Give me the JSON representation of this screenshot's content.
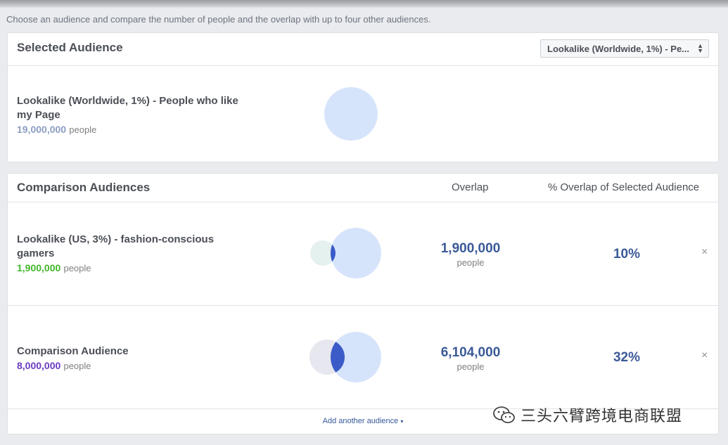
{
  "intro_text": "Choose an audience and compare the number of people and the overlap with up to four other audiences.",
  "selected_panel": {
    "title": "Selected Audience",
    "dropdown_value": "Lookalike (Worldwide, 1%) - Pe...",
    "audience": {
      "name": "Lookalike (Worldwide, 1%) - People who like my Page",
      "count": "19,000,000",
      "unit": "people",
      "count_color": "#8b9dc3",
      "circle_color": "#d6e4fb"
    }
  },
  "comparison_panel": {
    "title": "Comparison Audiences",
    "col_overlap": "Overlap",
    "col_percent": "% Overlap of Selected Audience",
    "rows": [
      {
        "name": "Lookalike (US, 3%) - fashion-conscious gamers",
        "count": "1,900,000",
        "unit": "people",
        "count_color": "#42b72a",
        "overlap": "1,900,000",
        "overlap_unit": "people",
        "percent": "10%",
        "close": "×",
        "compare_circle_color": "#e4f1ef",
        "overlap_color": "#3b5bc9"
      },
      {
        "name": "Comparison Audience",
        "count": "8,000,000",
        "unit": "people",
        "count_color": "#6a3bc0",
        "overlap": "6,104,000",
        "overlap_unit": "people",
        "percent": "32%",
        "close": "×",
        "compare_circle_color": "#e6e7ef",
        "overlap_color": "#3b5bc9"
      }
    ],
    "add_link": "Add another audience",
    "add_caret": "▾"
  },
  "watermark": {
    "icon": "wechat-icon",
    "text": "三头六臂跨境电商联盟"
  }
}
